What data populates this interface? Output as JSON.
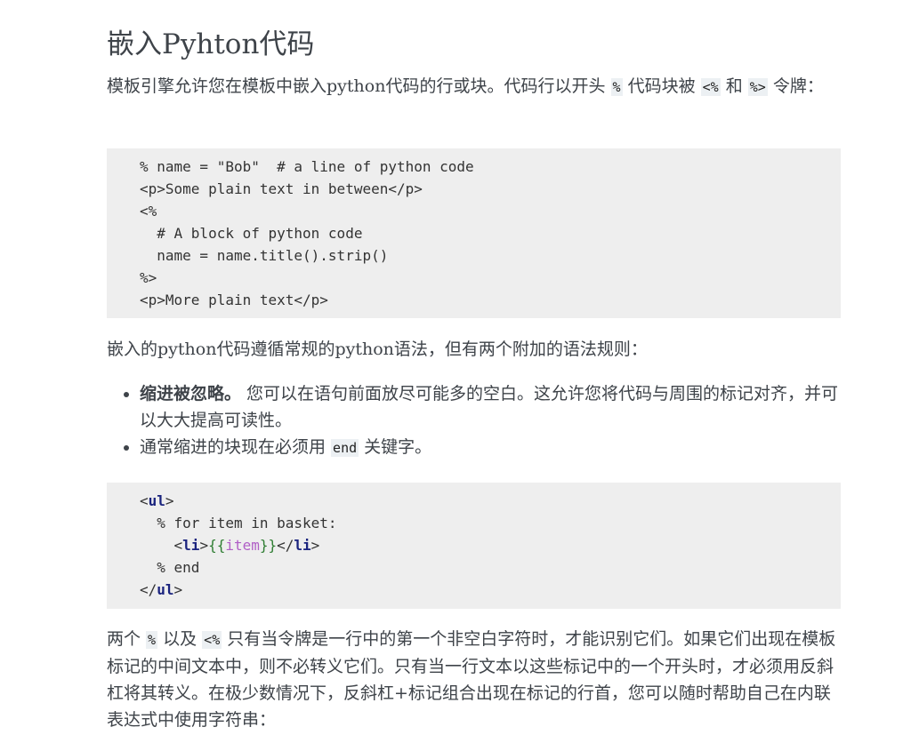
{
  "heading": "嵌入Pyhton代码",
  "intro": {
    "text_a": "模板引擎允许您在模板中嵌入python代码的行或块。代码行以开头 ",
    "code_percent": "%",
    "text_b": " 代码块被 ",
    "code_open": "<%",
    "text_c": " 和 ",
    "code_close": "%>",
    "text_d": " 令牌："
  },
  "code_block_1": {
    "lines": [
      "% name = \"Bob\"  # a line of python code",
      "<p>Some plain text in between</p>",
      "<%",
      "  # A block of python code",
      "  name = name.title().strip()",
      "%>",
      "<p>More plain text</p>"
    ]
  },
  "syntax_intro": "嵌入的python代码遵循常规的python语法，但有两个附加的语法规则：",
  "rules": {
    "rule1_bold": "缩进被忽略。",
    "rule1_text": " 您可以在语句前面放尽可能多的空白。这允许您将代码与周围的标记对齐，并可以大大提高可读性。",
    "rule2_text_a": "通常缩进的块现在必须用 ",
    "rule2_code": "end",
    "rule2_text_b": " 关键字。"
  },
  "code_block_2": {
    "l1_lt": "<",
    "l1_tag": "ul",
    "l1_gt": ">",
    "l2": "  % for item in basket:",
    "l3_indent": "    <",
    "l3_tag": "li",
    "l3_gt": ">",
    "l3_open": "{{",
    "l3_var": "item",
    "l3_close": "}}",
    "l3_lt_slash": "</",
    "l3_tag2": "li",
    "l3_gt2": ">",
    "l4": "  % end",
    "l5_lt_slash": "</",
    "l5_tag": "ul",
    "l5_gt": ">"
  },
  "outro": {
    "text_a": "两个 ",
    "code_percent": "%",
    "text_b": " 以及 ",
    "code_open": "<%",
    "text_c": " 只有当令牌是一行中的第一个非空白字符时，才能识别它们。如果它们出现在模板标记的中间文本中，则不必转义它们。只有当一行文本以这些标记中的一个开头时，才必须用反斜杠将其转义。在极少数情况下，反斜杠+标记组合出现在标记的行首，您可以随时帮助自己在内联表达式中使用字符串："
  }
}
